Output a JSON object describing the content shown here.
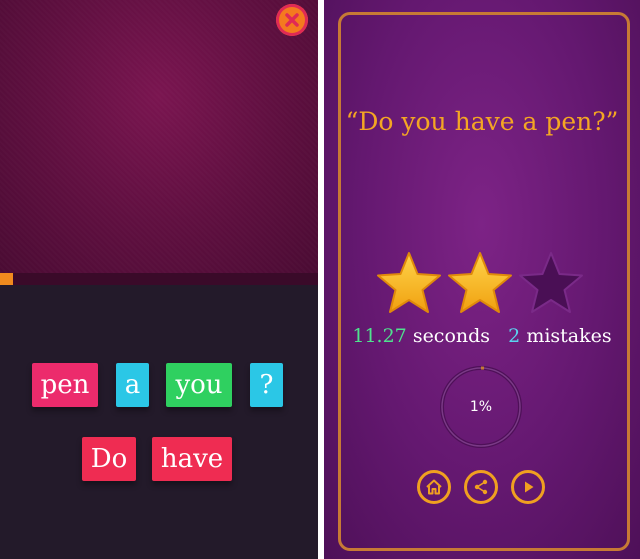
{
  "left_screen": {
    "progress_fraction": 0.04,
    "close_icon": "close-x-icon",
    "tiles_row1": [
      "pen",
      "a",
      "you",
      "?"
    ],
    "tiles_row2": [
      "Do",
      "have"
    ],
    "colors": {
      "pink": "#ec2b6c",
      "cyan": "#2bc7e6",
      "green": "#2fd060",
      "red": "#ef2c52",
      "progress": "#f08a1e"
    }
  },
  "right_screen": {
    "quote": "“Do you have a pen?”",
    "stars_earned": 2,
    "stars_total": 3,
    "time_value": "11.27",
    "time_unit": "seconds",
    "mistakes_value": "2",
    "mistakes_unit": "mistakes",
    "progress_percent_label": "1%",
    "buttons": [
      "home-icon",
      "share-icon",
      "play-icon"
    ],
    "colors": {
      "accent": "#f4a623",
      "frame": "#c77a35",
      "green_num": "#4fe28e",
      "cyan_num": "#5ad4f0"
    }
  }
}
